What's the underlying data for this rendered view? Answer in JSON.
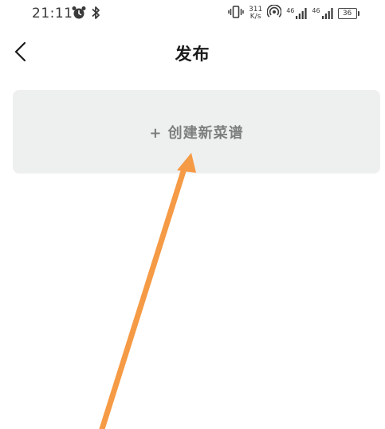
{
  "status_bar": {
    "time": "21:11",
    "net_speed_value": "311",
    "net_speed_unit": "K/s",
    "signal1_label": "46",
    "signal2_label": "46",
    "battery_level": "36"
  },
  "header": {
    "title": "发布"
  },
  "create_card": {
    "label": "+ 创建新菜谱"
  },
  "colors": {
    "card_bg": "#eef0ef",
    "card_text": "#7c7f7e",
    "annotation_arrow": "#f59a45"
  }
}
